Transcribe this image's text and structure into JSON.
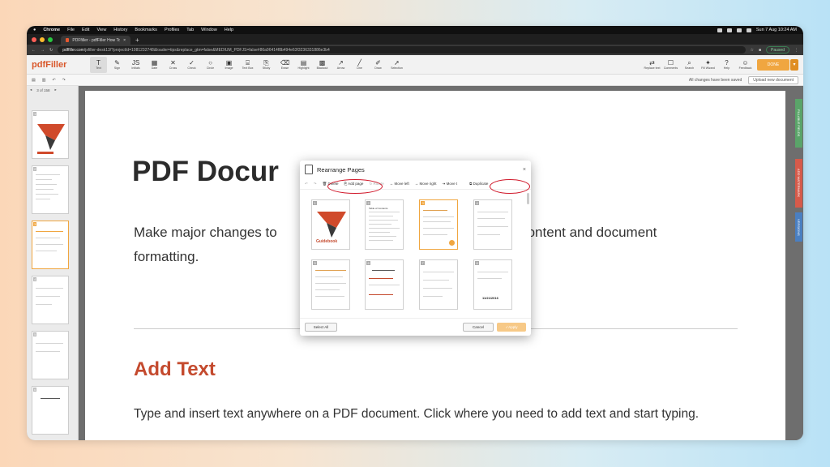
{
  "menubar": {
    "items": [
      "Chrome",
      "File",
      "Edit",
      "View",
      "History",
      "Bookmarks",
      "Profiles",
      "Tab",
      "Window",
      "Help"
    ],
    "clock": "Sun 7 Aug  10:24 AM"
  },
  "browser": {
    "tab_title": "PDFfiller - pdfFiller How To Do",
    "url_host": "pdffiller.com",
    "url_rest": "/jsfiller-desk13/?projectId=1081232748&loader=tips&replace_gtm=false&MEDIUM_PDFJS=false#86a96414f8b494e63f3236331886e3b4",
    "paused": "Paused"
  },
  "app": {
    "logo": "pdfFiller",
    "tools": [
      {
        "glyph": "T",
        "label": "Text"
      },
      {
        "glyph": "✎",
        "label": "Sign"
      },
      {
        "glyph": "JS",
        "label": "Initials"
      },
      {
        "glyph": "▦",
        "label": "Date"
      },
      {
        "glyph": "✕",
        "label": "Cross"
      },
      {
        "glyph": "✓",
        "label": "Check"
      },
      {
        "glyph": "○",
        "label": "Circle"
      },
      {
        "glyph": "▣",
        "label": "Image"
      },
      {
        "glyph": "⌸",
        "label": "Text Box"
      },
      {
        "glyph": "⎘",
        "label": "Sticky"
      },
      {
        "glyph": "⌫",
        "label": "Erase"
      },
      {
        "glyph": "▤",
        "label": "Highlight"
      },
      {
        "glyph": "▩",
        "label": "Blackout"
      },
      {
        "glyph": "↗",
        "label": "Arrow"
      },
      {
        "glyph": "╱",
        "label": "Line"
      },
      {
        "glyph": "✐",
        "label": "Draw"
      },
      {
        "glyph": "➚",
        "label": "Selection"
      }
    ],
    "right_tools": [
      {
        "glyph": "⇄",
        "label": "Replace text"
      },
      {
        "glyph": "☐",
        "label": "Comments"
      },
      {
        "glyph": "⌕",
        "label": "Search"
      },
      {
        "glyph": "✦",
        "label": "Fill Wizard"
      },
      {
        "glyph": "?",
        "label": "Help"
      },
      {
        "glyph": "☺",
        "label": "Feedback"
      }
    ],
    "done": "DONE",
    "saved_status": "All changes have been saved",
    "upload": "Upload new document",
    "pager": "3 of 158"
  },
  "document": {
    "title": "PDF Docur",
    "para1": "Make major changes to                                                       sting content and document formatting.",
    "heading2": "Add Text",
    "para2": "Type and insert text anywhere on a PDF document. Click where you need to add text and start typing."
  },
  "side_tabs": [
    "FILLABLE FIELDS",
    "ADD WATERMARK",
    "VERSIONS"
  ],
  "modal": {
    "title": "Rearrange Pages",
    "close": "×",
    "tools": {
      "delete": "Delete",
      "add_page": "Add page",
      "rotate": "Rotate",
      "move_left": "Move left",
      "move_right": "Move right",
      "move_to": "Move t",
      "duplicate": "Duplicate"
    },
    "pages": [
      "1",
      "2",
      "3",
      "4",
      "5",
      "6",
      "7",
      "8"
    ],
    "selected_page": "3",
    "select_all": "Select All",
    "cancel": "Cancel",
    "apply": "Apply",
    "guidebook": "Guidebook",
    "toc": "Table of Contents",
    "date_sample": "11/21/2016"
  }
}
